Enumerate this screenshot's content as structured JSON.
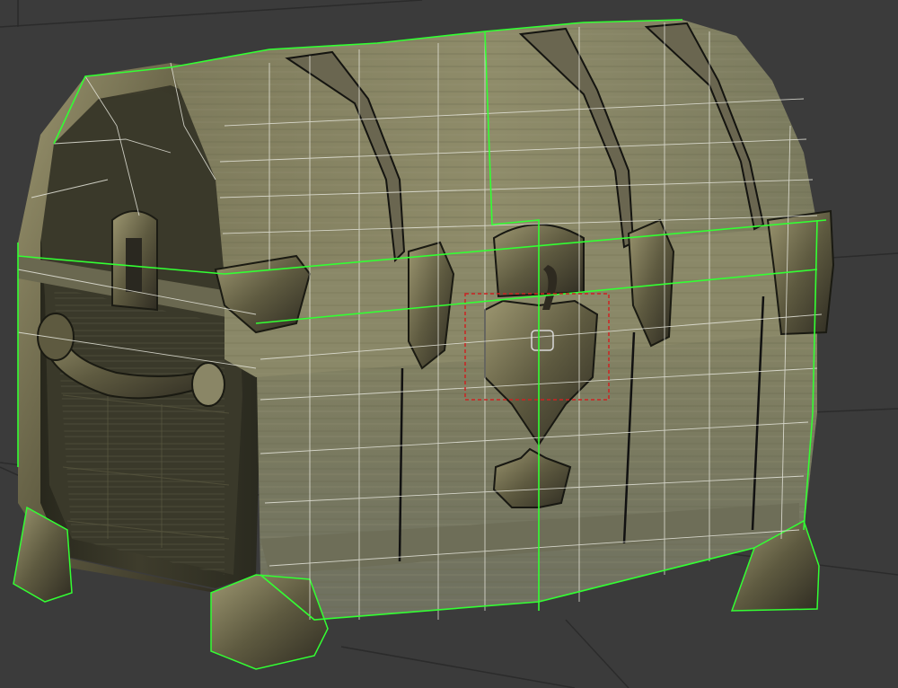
{
  "viewport": {
    "background": "#3b3b3b",
    "grid_color": "#2a2a2a"
  },
  "model": {
    "object": "treasure-chest",
    "display_mode": "textured-with-wireframe",
    "selected": true,
    "colors": {
      "wood": "#7d7a5a",
      "wood_dark": "#5a5840",
      "wood_light": "#9a9a78",
      "metal": "#6a6548",
      "metal_dark": "#2a2820",
      "side_panel": "#3b3a2b",
      "edge_highlight": "#33ff33",
      "wire": "#e8e8e0"
    }
  },
  "selection_gizmo": {
    "shape": "dashed-rectangle",
    "color": "#cc2222"
  }
}
